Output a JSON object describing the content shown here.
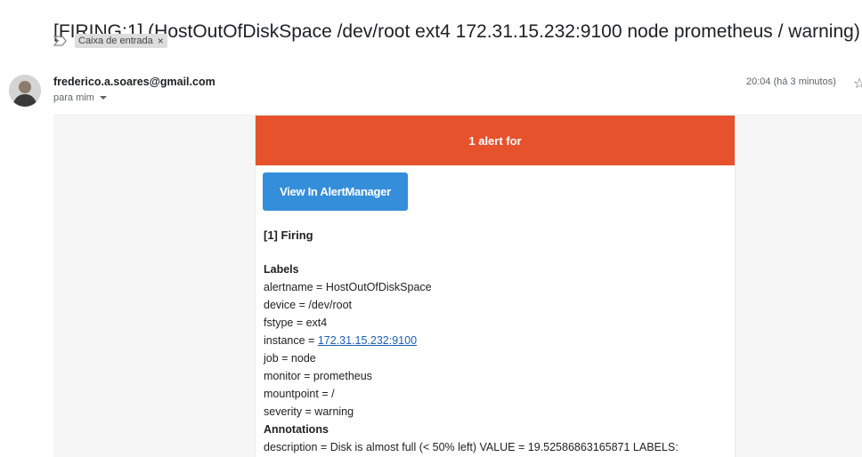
{
  "subject": "[FIRING:1] (HostOutOfDiskSpace /dev/root ext4 172.31.15.232:9100 node prometheus / warning)",
  "label_chip": "Caixa de entrada",
  "label_chip_close": "×",
  "sender": "frederico.a.soares@gmail.com",
  "to": "para mim",
  "timestamp": "20:04 (há 3 minutos)",
  "star_glyph": "☆",
  "email": {
    "banner": "1 alert for",
    "button_label": "View In AlertManager",
    "firing_title": "[1] Firing",
    "labels_title": "Labels",
    "labels": [
      "alertname = HostOutOfDiskSpace",
      "device = /dev/root",
      "fstype = ext4"
    ],
    "instance_key": "instance = ",
    "instance_link": "172.31.15.232:9100",
    "labels_more": [
      "job = node",
      "monitor = prometheus",
      "mountpoint = /",
      "severity = warning"
    ],
    "annotations_title": "Annotations",
    "description": "description = Disk is almost full (< 50% left) VALUE = 19.52586863165871 LABELS:"
  },
  "colors": {
    "banner": "#e6522c",
    "button": "#348eda",
    "link": "#1a5fb4"
  }
}
